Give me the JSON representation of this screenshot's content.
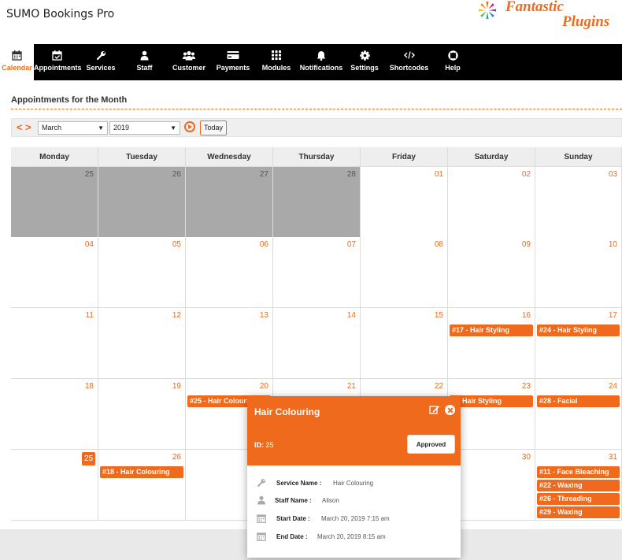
{
  "app": {
    "title": "SUMO Bookings Pro",
    "brand_line1": "Fantastic",
    "brand_line2": "Plugins"
  },
  "nav": [
    {
      "label": "Calendar",
      "icon": "calendar-icon",
      "active": true
    },
    {
      "label": "Appointments",
      "icon": "calendar-check-icon"
    },
    {
      "label": "Services",
      "icon": "wrench-icon"
    },
    {
      "label": "Staff",
      "icon": "user-icon"
    },
    {
      "label": "Customer",
      "icon": "users-icon"
    },
    {
      "label": "Payments",
      "icon": "credit-card-icon"
    },
    {
      "label": "Modules",
      "icon": "grid-icon"
    },
    {
      "label": "Notifications",
      "icon": "bell-icon"
    },
    {
      "label": "Settings",
      "icon": "gear-icon"
    },
    {
      "label": "Shortcodes",
      "icon": "code-icon"
    },
    {
      "label": "Help",
      "icon": "lifebuoy-icon"
    }
  ],
  "page": {
    "section_title": "Appointments for the Month"
  },
  "toolbar": {
    "prev": "<",
    "next": ">",
    "month": "March",
    "year": "2019",
    "today_label": "Today"
  },
  "calendar": {
    "weekdays": [
      "Monday",
      "Tuesday",
      "Wednesday",
      "Thursday",
      "Friday",
      "Saturday",
      "Sunday"
    ],
    "weeks": [
      [
        {
          "d": "25",
          "past": true
        },
        {
          "d": "26",
          "past": true
        },
        {
          "d": "27",
          "past": true
        },
        {
          "d": "28",
          "past": true
        },
        {
          "d": "01"
        },
        {
          "d": "02"
        },
        {
          "d": "03"
        }
      ],
      [
        {
          "d": "04"
        },
        {
          "d": "05"
        },
        {
          "d": "06"
        },
        {
          "d": "07"
        },
        {
          "d": "08"
        },
        {
          "d": "09"
        },
        {
          "d": "10"
        }
      ],
      [
        {
          "d": "11"
        },
        {
          "d": "12"
        },
        {
          "d": "13"
        },
        {
          "d": "14"
        },
        {
          "d": "15"
        },
        {
          "d": "16",
          "events": [
            "#17 - Hair Styling"
          ]
        },
        {
          "d": "17",
          "events": [
            "#24 - Hair Styling"
          ]
        }
      ],
      [
        {
          "d": "18"
        },
        {
          "d": "19"
        },
        {
          "d": "20",
          "events": [
            "#25 - Hair Colouring"
          ]
        },
        {
          "d": "21"
        },
        {
          "d": "22"
        },
        {
          "d": "23",
          "events": [
            "0 - Hair Styling"
          ]
        },
        {
          "d": "24",
          "events": [
            "#28 - Facial"
          ]
        }
      ],
      [
        {
          "d": "25",
          "today": true
        },
        {
          "d": "26",
          "events": [
            "#18 - Hair Colouring"
          ]
        },
        {
          "d": ""
        },
        {
          "d": ""
        },
        {
          "d": ""
        },
        {
          "d": "30"
        },
        {
          "d": "31",
          "events": [
            "#11 - Face Bleaching",
            "#22 - Waxing",
            "#26 - Threading",
            "#29 - Waxing"
          ]
        }
      ]
    ]
  },
  "popup": {
    "title": "Hair Colouring",
    "id_label": "ID:",
    "id_value": "25",
    "status": "Approved",
    "details": [
      {
        "label": "Service Name :",
        "value": "Hair Colouring",
        "icon": "wrench-icon"
      },
      {
        "label": "Staff Name :",
        "value": "Alison",
        "icon": "user-icon"
      },
      {
        "label": "Start Date :",
        "value": "March 20, 2019 7:15 am",
        "icon": "calendar-icon"
      },
      {
        "label": "End Date :",
        "value": "March 20, 2019 8:15 am",
        "icon": "calendar-icon"
      }
    ]
  },
  "colors": {
    "accent": "#f06a1d",
    "nav_bg": "#000000",
    "past_day": "#a9a9a9"
  }
}
